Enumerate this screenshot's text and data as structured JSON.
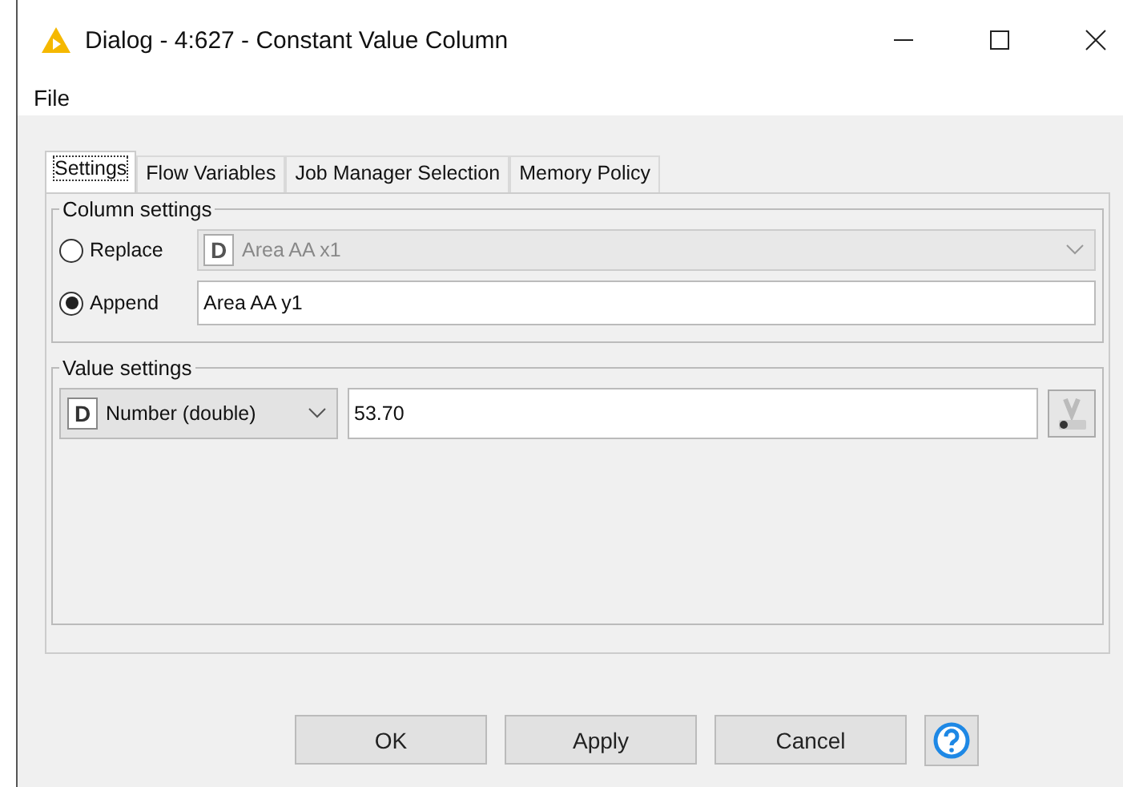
{
  "window": {
    "title": "Dialog - 4:627 - Constant Value Column"
  },
  "menu": [
    "File"
  ],
  "tabs": [
    {
      "label": "Settings",
      "selected": true
    },
    {
      "label": "Flow Variables",
      "selected": false
    },
    {
      "label": "Job Manager Selection",
      "selected": false
    },
    {
      "label": "Memory Policy",
      "selected": false
    }
  ],
  "column_settings": {
    "title": "Column settings",
    "options": [
      {
        "label": "Replace",
        "selected": false,
        "type_badge": "D",
        "value": "Area AA x1",
        "kind": "dropdown",
        "disabled": true
      },
      {
        "label": "Append",
        "selected": true,
        "value": "Area AA y1",
        "kind": "text"
      }
    ]
  },
  "value_settings": {
    "title": "Value settings",
    "type": {
      "badge": "D",
      "label": "Number (double)"
    },
    "value": "53.70"
  },
  "buttons": [
    "OK",
    "Apply",
    "Cancel"
  ]
}
